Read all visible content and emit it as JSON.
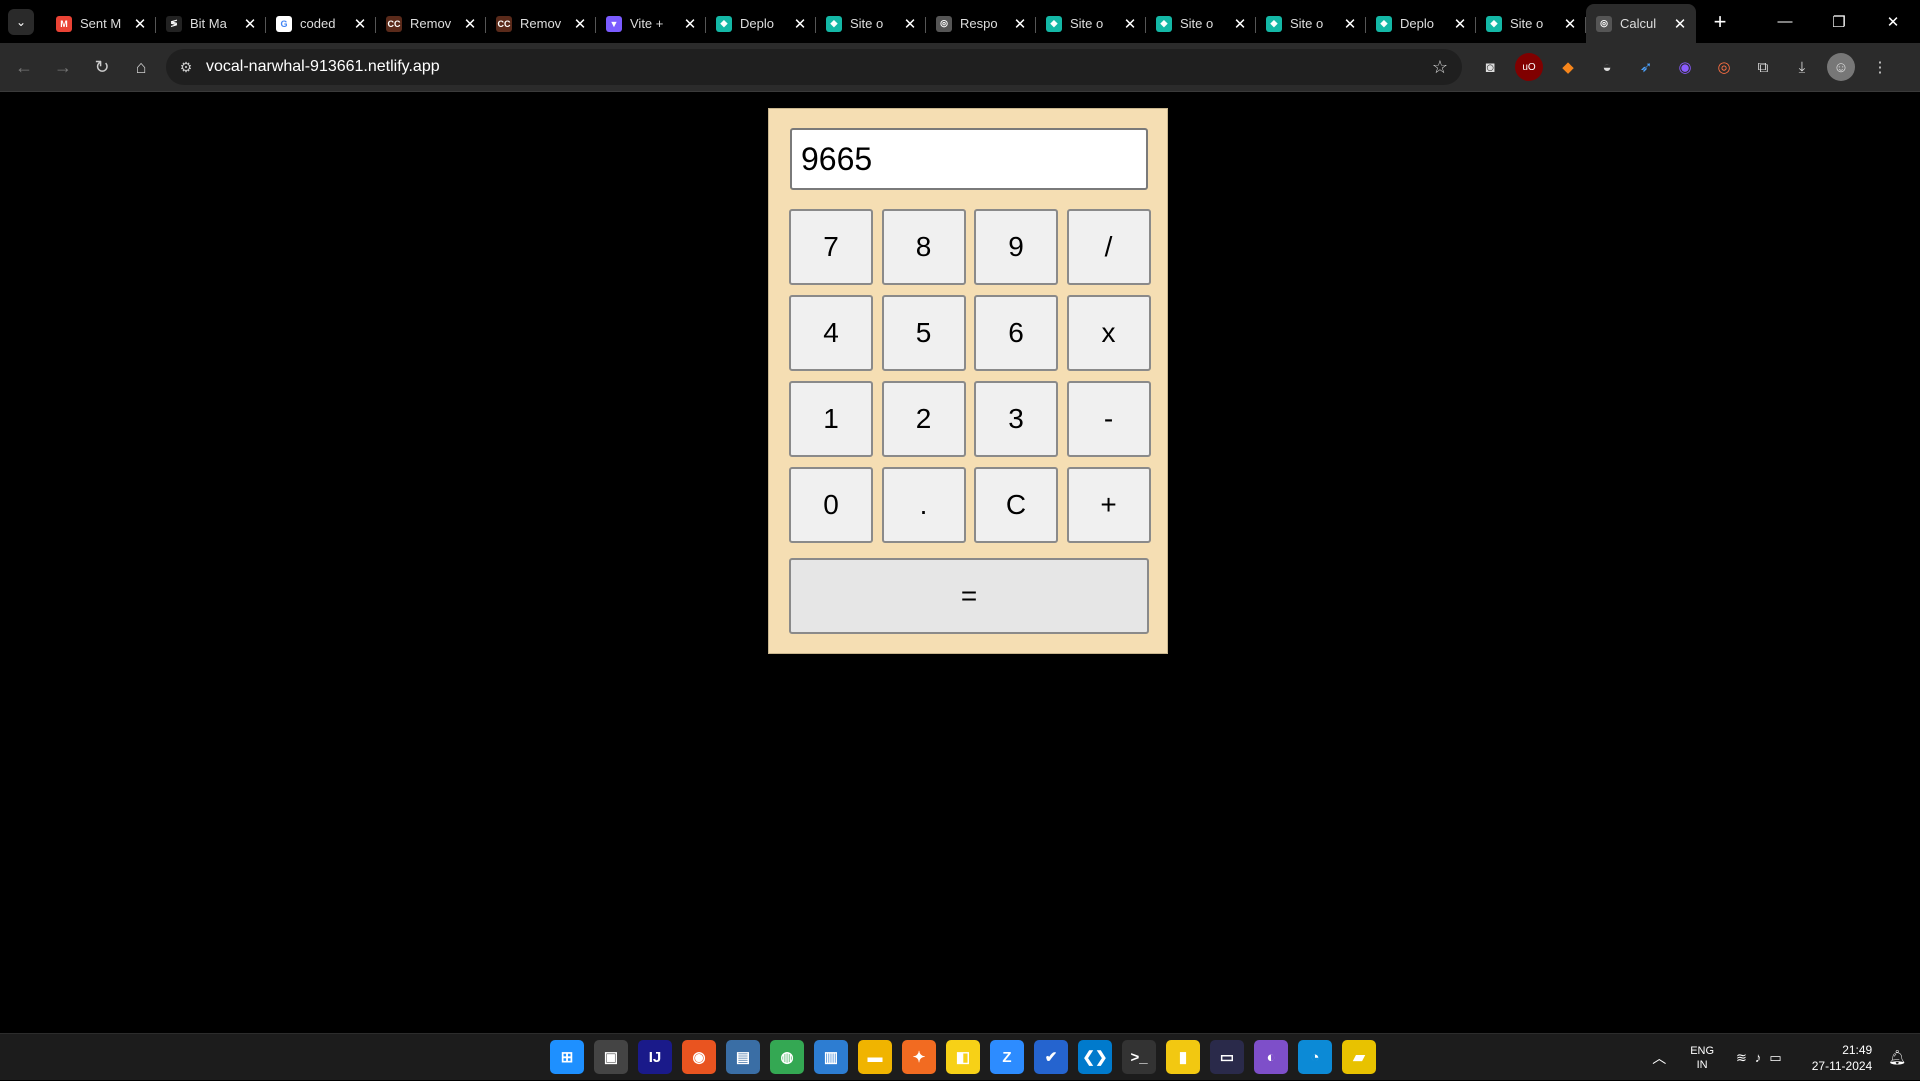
{
  "browser": {
    "tabs": [
      {
        "title": "Sent M",
        "icon": "gmail-icon",
        "color": "#ea4335",
        "glyph": "M"
      },
      {
        "title": "Bit Ma",
        "icon": "bolt-icon",
        "color": "#222222",
        "glyph": "≶"
      },
      {
        "title": "coded",
        "icon": "google-icon",
        "color": "#ffffff",
        "glyph": "G"
      },
      {
        "title": "Remov",
        "icon": "cc-icon",
        "color": "#5a2a1a",
        "glyph": "CC"
      },
      {
        "title": "Remov",
        "icon": "cc-icon",
        "color": "#5a2a1a",
        "glyph": "CC"
      },
      {
        "title": "Vite +",
        "icon": "vite-icon",
        "color": "#7b5cff",
        "glyph": "▼"
      },
      {
        "title": "Deplo",
        "icon": "netlify-icon",
        "color": "#14b8a6",
        "glyph": "◆"
      },
      {
        "title": "Site o",
        "icon": "netlify-icon",
        "color": "#14b8a6",
        "glyph": "◆"
      },
      {
        "title": "Respo",
        "icon": "globe-icon",
        "color": "#555555",
        "glyph": "◎"
      },
      {
        "title": "Site o",
        "icon": "netlify-icon",
        "color": "#14b8a6",
        "glyph": "◆"
      },
      {
        "title": "Site o",
        "icon": "netlify-icon",
        "color": "#14b8a6",
        "glyph": "◆"
      },
      {
        "title": "Site o",
        "icon": "netlify-icon",
        "color": "#14b8a6",
        "glyph": "◆"
      },
      {
        "title": "Deplo",
        "icon": "netlify-icon",
        "color": "#14b8a6",
        "glyph": "◆"
      },
      {
        "title": "Site o",
        "icon": "netlify-icon",
        "color": "#14b8a6",
        "glyph": "◆"
      },
      {
        "title": "Calcul",
        "icon": "globe-icon",
        "color": "#555555",
        "glyph": "◎",
        "active": true
      }
    ],
    "url": "vocal-narwhal-913661.netlify.app"
  },
  "calculator": {
    "display_value": "9665",
    "keys": [
      {
        "label": "7",
        "name": "key-7"
      },
      {
        "label": "8",
        "name": "key-8"
      },
      {
        "label": "9",
        "name": "key-9"
      },
      {
        "label": "/",
        "name": "key-divide"
      },
      {
        "label": "4",
        "name": "key-4"
      },
      {
        "label": "5",
        "name": "key-5"
      },
      {
        "label": "6",
        "name": "key-6"
      },
      {
        "label": "x",
        "name": "key-multiply"
      },
      {
        "label": "1",
        "name": "key-1"
      },
      {
        "label": "2",
        "name": "key-2"
      },
      {
        "label": "3",
        "name": "key-3"
      },
      {
        "label": "-",
        "name": "key-subtract"
      },
      {
        "label": "0",
        "name": "key-0"
      },
      {
        "label": ".",
        "name": "key-decimal"
      },
      {
        "label": "C",
        "name": "key-clear"
      },
      {
        "label": "+",
        "name": "key-add"
      }
    ],
    "equals_label": "=",
    "panel_color": "#f5deb3"
  },
  "taskbar": {
    "apps": [
      {
        "name": "start-icon",
        "glyph": "⊞",
        "color": "#1e90ff"
      },
      {
        "name": "task-view-icon",
        "glyph": "▣",
        "color": "#444444"
      },
      {
        "name": "intellij-icon",
        "glyph": "IJ",
        "color": "#1a1a8a"
      },
      {
        "name": "ubuntu-icon",
        "glyph": "◉",
        "color": "#e95420"
      },
      {
        "name": "photos-icon",
        "glyph": "▤",
        "color": "#3a6ea5"
      },
      {
        "name": "chrome-icon",
        "glyph": "◍",
        "color": "#34a853"
      },
      {
        "name": "notepad-icon",
        "glyph": "▥",
        "color": "#2d7dd2"
      },
      {
        "name": "file-explorer-icon",
        "glyph": "▬",
        "color": "#f0b400"
      },
      {
        "name": "compass-icon",
        "glyph": "✦",
        "color": "#f26b21"
      },
      {
        "name": "sticky-notes-icon",
        "glyph": "◧",
        "color": "#f7d117"
      },
      {
        "name": "zoom-icon",
        "glyph": "Z",
        "color": "#2d8cff"
      },
      {
        "name": "todo-icon",
        "glyph": "✔",
        "color": "#2564cf"
      },
      {
        "name": "vscode-icon",
        "glyph": "❮❯",
        "color": "#007acc"
      },
      {
        "name": "terminal-icon",
        "glyph": ">_",
        "color": "#333333"
      },
      {
        "name": "power-bi-icon",
        "glyph": "▮",
        "color": "#f2c811"
      },
      {
        "name": "card-icon",
        "glyph": "▭",
        "color": "#2a2a4a"
      },
      {
        "name": "tor-icon",
        "glyph": "◐",
        "color": "#7e4fc9"
      },
      {
        "name": "edge-icon",
        "glyph": "◔",
        "color": "#0c8ad6"
      },
      {
        "name": "folder-app-icon",
        "glyph": "▰",
        "color": "#e8c200"
      }
    ],
    "lang_top": "ENG",
    "lang_bottom": "IN",
    "time": "21:49",
    "date": "27-11-2024"
  }
}
